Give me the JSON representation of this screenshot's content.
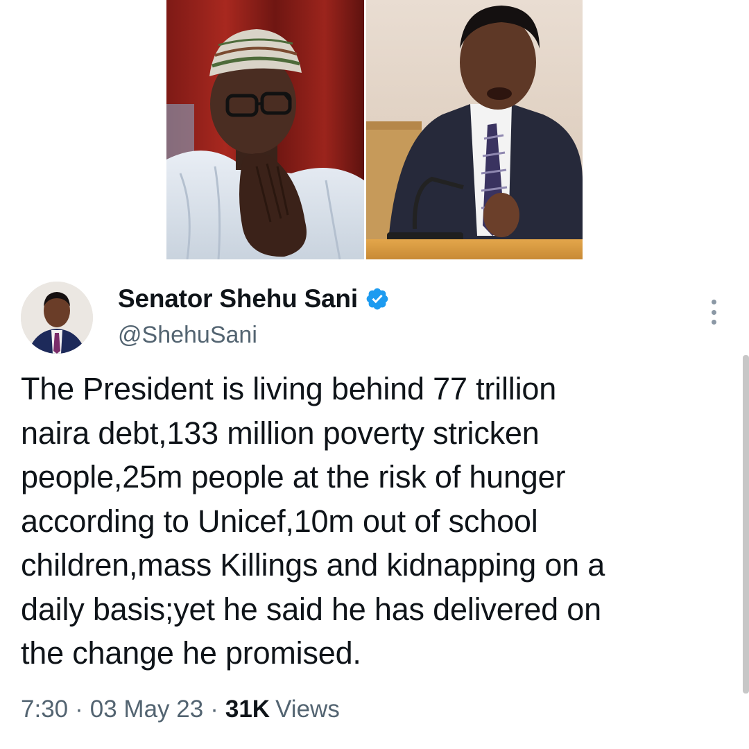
{
  "tweet": {
    "author": {
      "name": "Senator Shehu Sani",
      "handle": "@ShehuSani",
      "verified": true,
      "verified_color": "#1d9bf0"
    },
    "text_lines": [
      "The President is living behind 77 trillion",
      "naira debt,133 million poverty stricken",
      "people,25m people at the risk of hunger",
      "according to Unicef,10m out of school",
      "children,mass Killings and kidnapping on a",
      "daily basis;yet he said he has delivered on",
      "the change he promised."
    ],
    "meta": {
      "time": "7:30",
      "date": "03 May 23",
      "views_count": "31K",
      "views_label": "Views",
      "separator": "·"
    },
    "icons": {
      "verified": "verified-badge-icon",
      "more": "more-options-icon"
    }
  },
  "colors": {
    "text_primary": "#0f1419",
    "text_secondary": "#536471",
    "verified": "#1d9bf0"
  }
}
